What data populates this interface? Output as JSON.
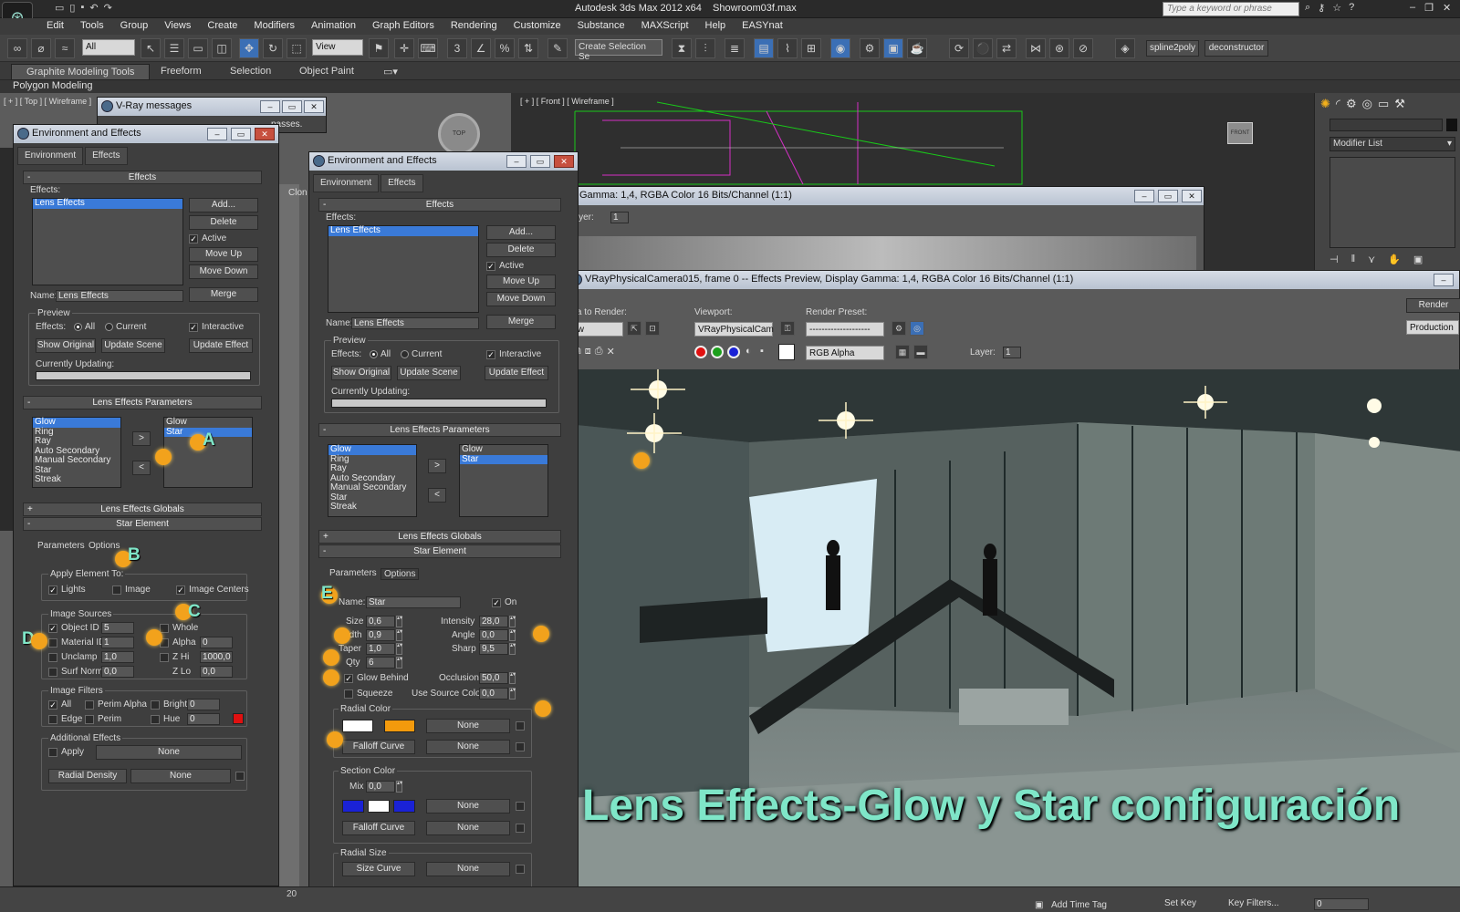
{
  "app": {
    "title": "Autodesk 3ds Max  2012 x64",
    "file": "Showroom03f.max",
    "search_placeholder": "Type a keyword or phrase"
  },
  "menu": [
    "Edit",
    "Tools",
    "Group",
    "Views",
    "Create",
    "Modifiers",
    "Animation",
    "Graph Editors",
    "Rendering",
    "Customize",
    "Substance",
    "MAXScript",
    "Help",
    "EASYnat"
  ],
  "toolbar": {
    "filter": "All",
    "refcoord": "View",
    "selset": "Create Selection Se",
    "spline2poly": "spline2poly",
    "deconstructor": "deconstructor"
  },
  "ribbon": {
    "tabs": [
      "Graphite Modeling Tools",
      "Freeform",
      "Selection",
      "Object Paint"
    ],
    "sub": "Polygon Modeling"
  },
  "viewports": {
    "top": "[ + ] [ Top ] [ Wireframe ]",
    "front": "[ + ] [ Front ] [ Wireframe ]",
    "front_cube": "FRONT",
    "top_cube": "TOP",
    "vray_msg": "V-Ray messages",
    "vray_msg_text": "passes.",
    "clone_label": "Clon"
  },
  "right_panel": {
    "modifier_list": "Modifier List"
  },
  "env_left": {
    "title": "Environment and Effects",
    "tabs": [
      "Environment",
      "Effects"
    ],
    "effects_hdr": "Effects",
    "effects_lbl": "Effects:",
    "effects_list": [
      "Lens Effects"
    ],
    "add": "Add...",
    "delete": "Delete",
    "active": "Active",
    "move_up": "Move Up",
    "move_down": "Move Down",
    "name_lbl": "Name:",
    "name": "Lens Effects",
    "merge": "Merge",
    "preview": "Preview",
    "effects2": "Effects:",
    "all": "All",
    "current": "Current",
    "interactive": "Interactive",
    "show_original": "Show Original",
    "update_scene": "Update Scene",
    "update_effect": "Update Effect",
    "currently_updating": "Currently Updating:",
    "lep_hdr": "Lens Effects Parameters",
    "lep_list": [
      "Glow",
      "Ring",
      "Ray",
      "Auto Secondary",
      "Manual Secondary",
      "Star",
      "Streak"
    ],
    "lep_sel": [
      "Glow",
      "Star"
    ],
    "globals": "Lens Effects Globals",
    "star_element": "Star Element",
    "sub_tabs": [
      "Parameters",
      "Options"
    ],
    "apply_to": "Apply Element To:",
    "lights": "Lights",
    "image": "Image",
    "image_centers": "Image Centers",
    "sources": "Image Sources",
    "object_id": "Object ID",
    "object_id_val": "5",
    "whole": "Whole",
    "material_id": "Material ID",
    "material_id_val": "1",
    "alpha": "Alpha",
    "alpha_val": "0",
    "unclamp": "Unclamp",
    "unclamp_val": "1,0",
    "zhi": "Z Hi",
    "zhi_val": "1000,0",
    "surf_norm": "Surf Norm",
    "surf_norm_val": "0,0",
    "zlo": "Z Lo",
    "zlo_val": "0,0",
    "filters": "Image Filters",
    "all_f": "All",
    "perim_alpha": "Perim Alpha",
    "bright": "Bright",
    "bright_val": "0",
    "edge": "Edge",
    "perim": "Perim",
    "hue": "Hue",
    "hue_val": "0",
    "additional": "Additional Effects",
    "apply": "Apply",
    "none": "None",
    "radial_density": "Radial Density",
    "none2": "None"
  },
  "env_right": {
    "title": "Environment and Effects",
    "tabs": [
      "Environment",
      "Effects"
    ],
    "effects_hdr": "Effects",
    "effects_lbl": "Effects:",
    "effects_list": [
      "Lens Effects"
    ],
    "add": "Add...",
    "delete": "Delete",
    "active": "Active",
    "move_up": "Move Up",
    "move_down": "Move Down",
    "name_lbl": "Name:",
    "name": "Lens Effects",
    "merge": "Merge",
    "preview": "Preview",
    "effects2": "Effects:",
    "all": "All",
    "current": "Current",
    "interactive": "Interactive",
    "show_original": "Show Original",
    "update_scene": "Update Scene",
    "update_effect": "Update Effect",
    "currently_updating": "Currently Updating:",
    "lep_hdr": "Lens Effects Parameters",
    "lep_list": [
      "Glow",
      "Ring",
      "Ray",
      "Auto Secondary",
      "Manual Secondary",
      "Star",
      "Streak"
    ],
    "lep_sel": [
      "Glow",
      "Star"
    ],
    "globals": "Lens Effects Globals",
    "star_element": "Star Element",
    "sub_tabs": [
      "Parameters",
      "Options"
    ],
    "name2_lbl": "Name:",
    "name2": "Star",
    "on": "On",
    "size": "Size",
    "size_val": "0,6",
    "intensity": "Intensity",
    "intensity_val": "28,0",
    "width": "Width",
    "width_val": "0,9",
    "angle": "Angle",
    "angle_val": "0,0",
    "taper": "Taper",
    "taper_val": "1,0",
    "sharp": "Sharp",
    "sharp_val": "9,5",
    "qty": "Qty",
    "qty_val": "6",
    "glow_behind": "Glow Behind",
    "occlusion": "Occlusion",
    "occlusion_val": "50,0",
    "squeeze": "Squeeze",
    "use_source_color": "Use Source Color",
    "usc_val": "0,0",
    "radial_color": "Radial Color",
    "none": "None",
    "falloff_curve": "Falloff Curve",
    "none_b": "None",
    "section_color": "Section Color",
    "mix": "Mix",
    "mix_val": "0,0",
    "none_c": "None",
    "falloff_curve2": "Falloff Curve",
    "none_d": "None",
    "radial_size": "Radial Size",
    "size_curve": "Size Curve",
    "none_e": "None"
  },
  "frame_back": {
    "title": "Gamma: 1,4, RGBA Color 16 Bits/Channel (1:1)",
    "layer": "Layer:",
    "layer_val": "1"
  },
  "frame": {
    "title": "VRayPhysicalCamera015, frame 0 -- Effects Preview, Display Gamma: 1,4, RGBA Color 16 Bits/Channel (1:1)",
    "area_lbl": "rea to Render:",
    "area_val": "iew",
    "viewport_lbl": "Viewport:",
    "viewport_val": "VRayPhysicalCam",
    "preset_lbl": "Render Preset:",
    "preset_val": "--------------------",
    "render": "Render",
    "production": "Production",
    "channel": "RGB Alpha",
    "layer": "Layer:",
    "layer_val": "1"
  },
  "markers": [
    "A",
    "B",
    "C",
    "D",
    "E"
  ],
  "caption": "Lens Effects-Glow y Star configuración",
  "status": {
    "add_time_tag": "Add Time Tag",
    "set_key": "Set Key",
    "key_filters": "Key Filters...",
    "frame_val": "0",
    "ruler": "20"
  },
  "colors": {
    "marker": "#f2a21c",
    "caption": "#7fe6c8",
    "radial1": "#ffffff",
    "radial2": "#f39a0c",
    "section1": "#1a22d6",
    "section2": "#ffffff",
    "section3": "#1a22d6",
    "hue_swatch": "#e01010"
  }
}
